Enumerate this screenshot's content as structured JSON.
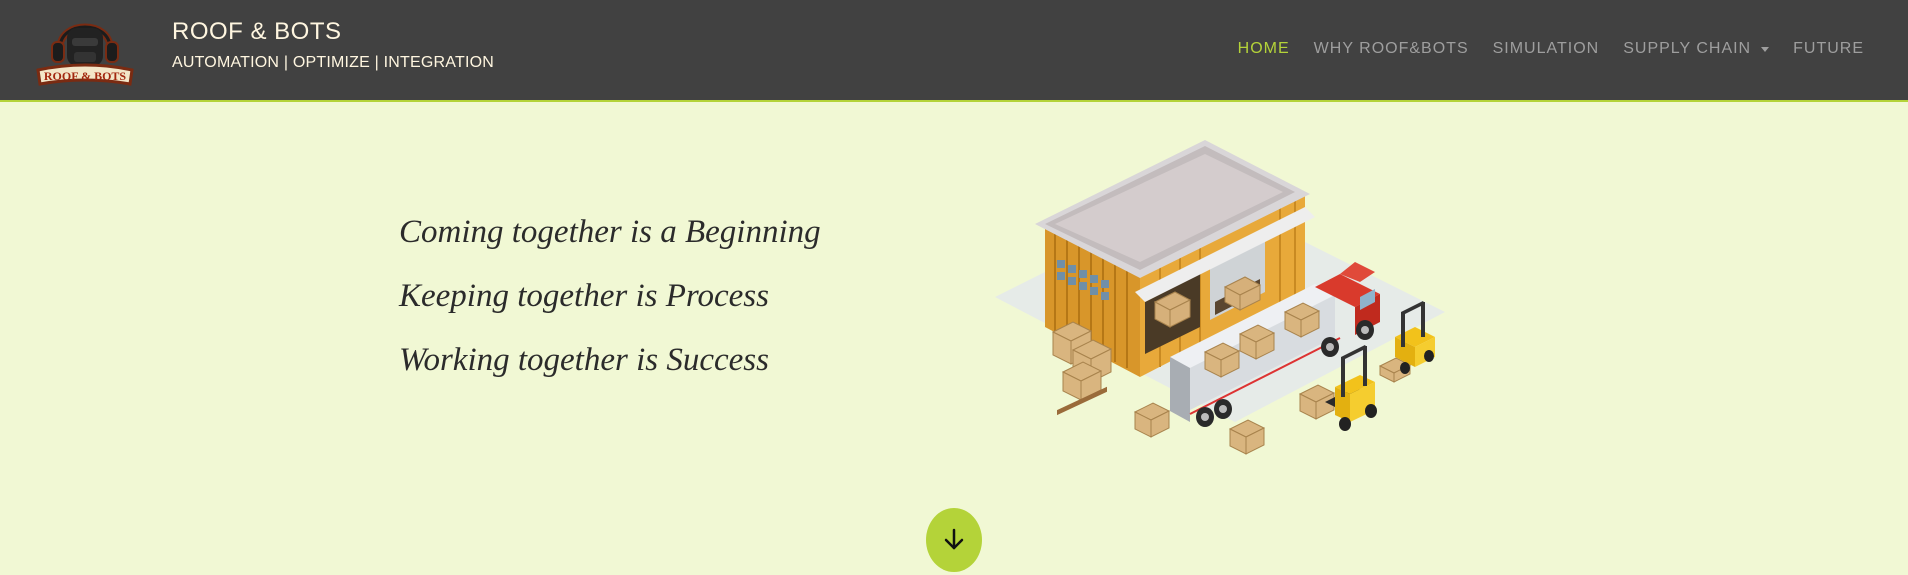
{
  "brand": {
    "title": "ROOF & BOTS",
    "tagline": "AUTOMATION | OPTIMIZE | INTEGRATION",
    "logo_text": "ROOF & BOTS"
  },
  "nav": {
    "home": "HOME",
    "why": "WHY ROOF&BOTS",
    "simulation": "SIMULATION",
    "supply_chain": "SUPPLY CHAIN",
    "future": "FUTURE"
  },
  "hero": {
    "line1": "Coming together is a Beginning",
    "line2": "Keeping together is Process",
    "line3": "Working together is Success",
    "illustration": "warehouse-truck-forklift-illustration"
  },
  "icons": {
    "scroll": "arrow-down-icon",
    "dropdown": "caret-down-icon"
  },
  "colors": {
    "header_bg": "#414141",
    "accent": "#b4d339",
    "page_bg": "#f1f8d4",
    "nav_text": "#9e9e9e"
  }
}
